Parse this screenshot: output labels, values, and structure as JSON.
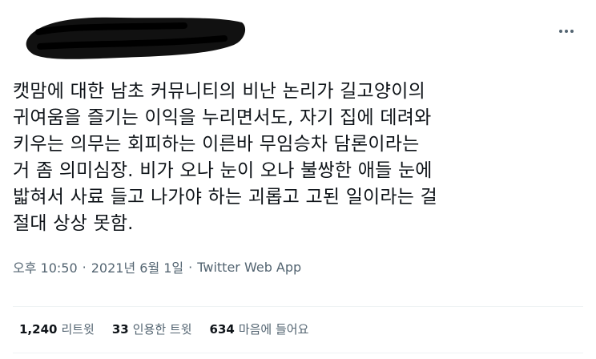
{
  "tweet": {
    "lines": [
      "캣맘에 대한 남초 커뮤니티의 비난 논리가 길고양이의",
      "귀여움을 즐기는 이익을 누리면서도, 자기 집에 데려와",
      "키우는 의무는 회피하는 이른바 무임승차 담론이라는",
      "거 좀 의미심장. 비가 오나 눈이 오나 불쌍한 애들 눈에",
      "밟혀서 사료 들고 나가야 하는 괴롭고 고된 일이라는 걸",
      "절대 상상 못함."
    ],
    "time": "오후 10:50",
    "separator": "·",
    "date": "2021년 6월 1일",
    "source": "Twitter Web App"
  },
  "stats": {
    "retweets": {
      "count": "1,240",
      "label": "리트윗"
    },
    "quotes": {
      "count": "33",
      "label": "인용한 트윗"
    },
    "likes": {
      "count": "634",
      "label": "마음에 들어요"
    }
  },
  "icons": {
    "more": "more-horizontal-icon"
  }
}
